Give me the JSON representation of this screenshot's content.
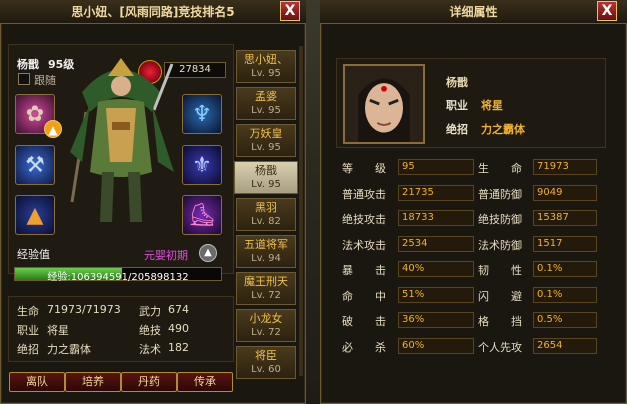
{
  "left_window": {
    "title": "思小妞、[风雨同路]竞技排名5",
    "close": "X",
    "hero_name": "杨戬",
    "hero_level": "95级",
    "follow_label": "跟随",
    "power_value": "27834",
    "exp_label": "经验值",
    "realm": "元婴初期",
    "exp_bar_text": "经验:106394591/205898132",
    "exp_fraction": 0.517,
    "stats": [
      {
        "label": "生命",
        "value": "71973/71973",
        "label2": "武力",
        "value2": "674"
      },
      {
        "label": "职业",
        "value": "将星",
        "label2": "绝技",
        "value2": "490"
      },
      {
        "label": "绝招",
        "value": "力之霸体",
        "label2": "法术",
        "value2": "182"
      }
    ],
    "buttons": [
      "离队",
      "培养",
      "丹药",
      "传承"
    ],
    "roster": [
      {
        "name": "思小妞、",
        "lv": "Lv. 95"
      },
      {
        "name": "孟婆",
        "lv": "Lv. 95"
      },
      {
        "name": "万妖皇",
        "lv": "Lv. 95"
      },
      {
        "name": "杨戬",
        "lv": "Lv. 95"
      },
      {
        "name": "黑羽",
        "lv": "Lv. 82"
      },
      {
        "name": "五道将军",
        "lv": "Lv. 94"
      },
      {
        "name": "魔王刑天",
        "lv": "Lv. 72"
      },
      {
        "name": "小龙女",
        "lv": "Lv. 72"
      },
      {
        "name": "将臣",
        "lv": "Lv. 60"
      }
    ]
  },
  "right_window": {
    "title": "详细属性",
    "close": "X",
    "name": "杨戬",
    "job_label": "职业",
    "job": "将星",
    "skill_label": "绝招",
    "skill": "力之霸体",
    "rows": [
      {
        "l1": "等　　级",
        "v1": "95",
        "l2": "生　　命",
        "v2": "71973"
      },
      {
        "l1": "普通攻击",
        "v1": "21735",
        "l2": "普通防御",
        "v2": "9049"
      },
      {
        "l1": "绝技攻击",
        "v1": "18733",
        "l2": "绝技防御",
        "v2": "15387"
      },
      {
        "l1": "法术攻击",
        "v1": "2534",
        "l2": "法术防御",
        "v2": "1517"
      },
      {
        "l1": "暴　　击",
        "v1": "40%",
        "l2": "韧　　性",
        "v2": "0.1%"
      },
      {
        "l1": "命　　中",
        "v1": "51%",
        "l2": "闪　　避",
        "v2": "0.1%"
      },
      {
        "l1": "破　　击",
        "v1": "36%",
        "l2": "格　　挡",
        "v2": "0.5%"
      },
      {
        "l1": "必　　杀",
        "v1": "60%",
        "l2": "个人先攻",
        "v2": "2654"
      }
    ]
  }
}
